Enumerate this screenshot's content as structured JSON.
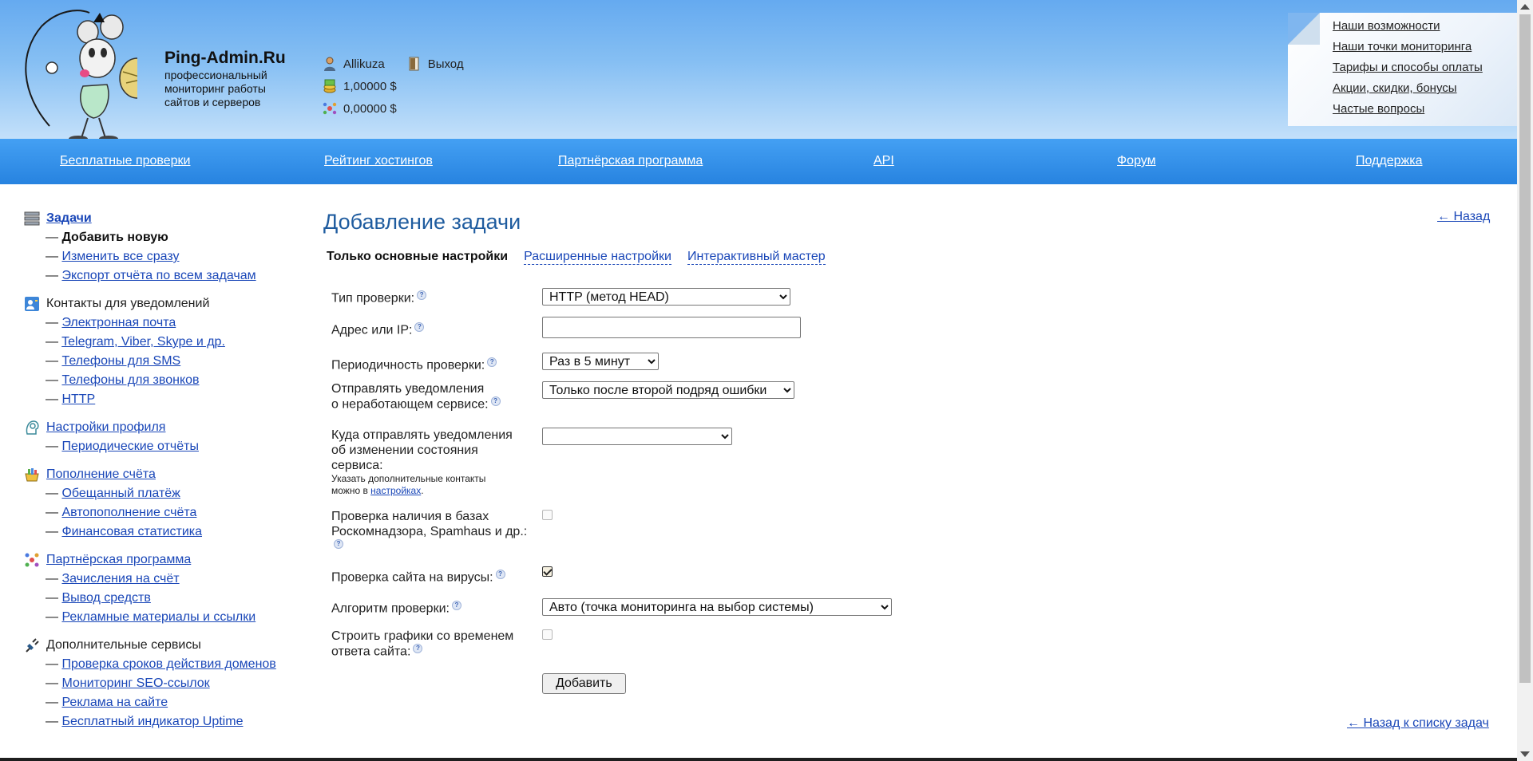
{
  "brand": {
    "name": "Ping-Admin.Ru",
    "tagline_lines": [
      "профессиональный",
      "мониторинг работы",
      "сайтов и серверов"
    ]
  },
  "user": {
    "username": "Allikuza",
    "logout": "Выход",
    "balance": "1,00000 $",
    "bonus_balance": "0,00000 $"
  },
  "top_menu": [
    "Наши возможности",
    "Наши точки мониторинга",
    "Тарифы и способы оплаты",
    "Акции, скидки, бонусы",
    "Частые вопросы"
  ],
  "nav": [
    "Бесплатные проверки",
    "Рейтинг хостингов",
    "Партнёрская программа",
    "API",
    "Форум",
    "Поддержка"
  ],
  "sidebar": [
    {
      "title": "Задачи",
      "link": true,
      "bold": true,
      "icon": "server-icon",
      "items": [
        {
          "label": "Добавить новую",
          "current": true
        },
        {
          "label": "Изменить все сразу"
        },
        {
          "label": "Экспорт отчёта по всем задачам"
        }
      ]
    },
    {
      "title": "Контакты для уведомлений",
      "link": false,
      "icon": "contacts-icon",
      "items": [
        {
          "label": "Электронная почта"
        },
        {
          "label": "Telegram, Viber, Skype и др."
        },
        {
          "label": "Телефоны для SMS"
        },
        {
          "label": "Телефоны для звонков"
        },
        {
          "label": "HTTP"
        }
      ]
    },
    {
      "title": "Настройки профиля",
      "link": true,
      "icon": "profile-settings-icon",
      "items": [
        {
          "label": "Периодические отчёты"
        }
      ]
    },
    {
      "title": "Пополнение счёта",
      "link": true,
      "icon": "wallet-icon",
      "items": [
        {
          "label": "Обещанный платёж"
        },
        {
          "label": "Автопополнение счёта"
        },
        {
          "label": "Финансовая статистика"
        }
      ]
    },
    {
      "title": "Партнёрская программа",
      "link": true,
      "icon": "partner-network-icon",
      "items": [
        {
          "label": "Зачисления на счёт"
        },
        {
          "label": "Вывод средств"
        },
        {
          "label": "Рекламные материалы и ссылки"
        }
      ]
    },
    {
      "title": "Дополнительные сервисы",
      "link": false,
      "icon": "plug-icon",
      "items": [
        {
          "label": "Проверка сроков действия доменов"
        },
        {
          "label": "Мониторинг SEO-ссылок"
        },
        {
          "label": "Реклама на сайте"
        },
        {
          "label": "Бесплатный индикатор Uptime"
        }
      ]
    }
  ],
  "page": {
    "title": "Добавление задачи",
    "back": "← Назад",
    "back_to_list": "← Назад к списку задач",
    "tabs": {
      "basic": "Только основные настройки",
      "advanced": "Расширенные настройки",
      "wizard": "Интерактивный мастер"
    }
  },
  "form": {
    "check_type": {
      "label": "Тип проверки:",
      "value": "HTTP (метод HEAD)"
    },
    "address": {
      "label": "Адрес или IP:",
      "value": ""
    },
    "interval": {
      "label": "Периодичность проверки:",
      "value": "Раз в 5 минут"
    },
    "notify": {
      "label_line1": "Отправлять уведомления",
      "label_line2": "о неработающем сервисе:",
      "value": "Только после второй подряд ошибки"
    },
    "notify_where": {
      "label_line1": "Куда отправлять уведомления",
      "label_line2": "об изменении состояния",
      "label_line3": "сервиса:",
      "note_line1": "Указать дополнительные контакты",
      "note_prefix": "можно в",
      "note_link": "настройках",
      "note_suffix": ".",
      "value": ""
    },
    "blacklist": {
      "label_line1": "Проверка наличия в базах",
      "label_line2": "Роскомнадзора, Spamhaus и др.:",
      "checked": false
    },
    "virus": {
      "label": "Проверка сайта на вирусы:",
      "checked": true
    },
    "algorithm": {
      "label": "Алгоритм проверки:",
      "value": "Авто (точка мониторинга на выбор системы)"
    },
    "graphs": {
      "label_line1": "Строить графики со временем",
      "label_line2": "ответа сайта:",
      "checked": false
    },
    "submit": "Добавить"
  }
}
